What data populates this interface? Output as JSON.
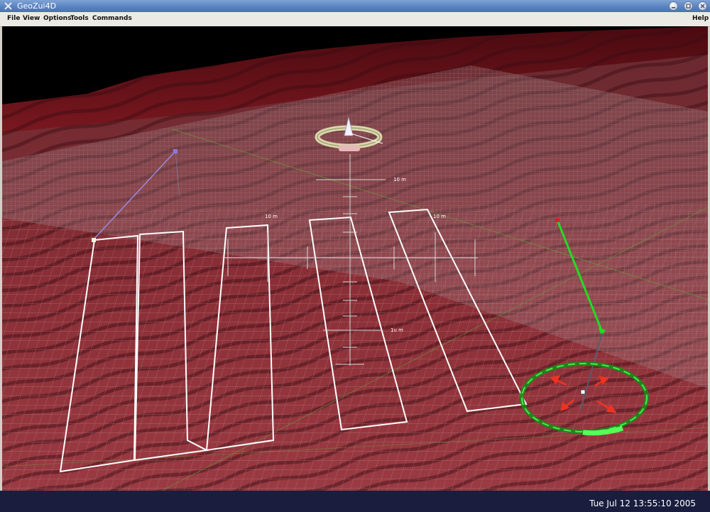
{
  "window": {
    "title": "GeoZui4D",
    "icon": "geozui-app-icon",
    "controls": [
      "minimize-icon",
      "maximize-icon",
      "close-icon"
    ]
  },
  "menubar": {
    "items": [
      "File",
      "View",
      "Options",
      "Tools",
      "Commands"
    ],
    "help": "Help"
  },
  "scene": {
    "scale_labels": [
      "10 m",
      "10 m",
      "10 m",
      "1u m"
    ],
    "colors": {
      "seafloor": "#7a2028",
      "grid": "#9a7a7e",
      "survey_lines": "#ffffff",
      "green_widget": "#22dd22",
      "red_arrows": "#ee3322"
    }
  },
  "status": {
    "datetime": "Tue Jul 12 13:55:10 2005"
  }
}
